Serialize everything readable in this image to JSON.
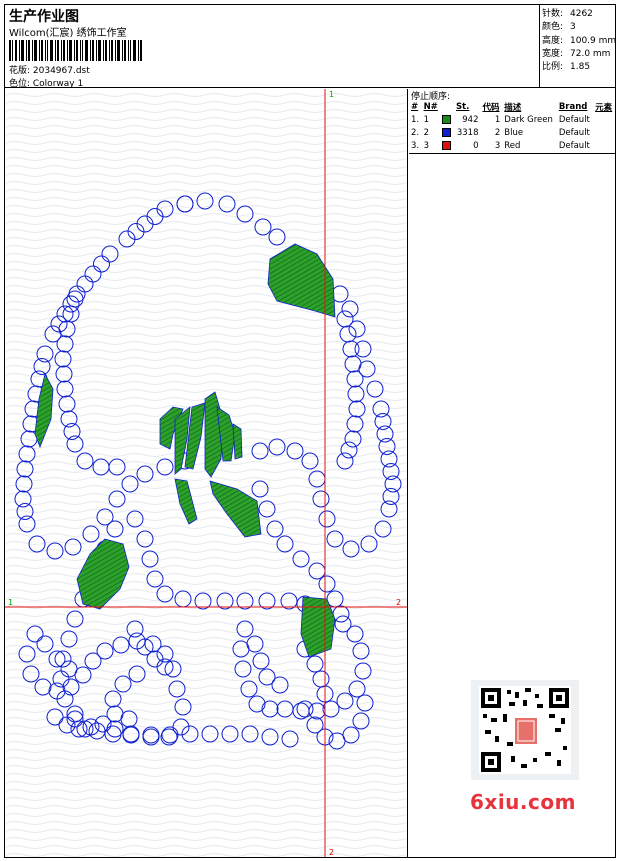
{
  "header": {
    "title": "生产作业图",
    "company": "Wilcom(汇宸) 绣饰工作室",
    "design_label": "花版: 2034967.dst",
    "colorway_label": "色位: Colorway 1"
  },
  "stats": [
    {
      "label": "针数:",
      "value": "4262"
    },
    {
      "label": "颜色:",
      "value": "3"
    },
    {
      "label": "高度:",
      "value": "100.9 mm"
    },
    {
      "label": "宽度:",
      "value": "72.0 mm"
    },
    {
      "label": "比例:",
      "value": "1.85"
    }
  ],
  "stop_sequence": {
    "heading": "停止顺序:",
    "columns": [
      "#",
      "N#",
      "St.",
      "代码",
      "描述",
      "Brand",
      "元素"
    ],
    "rows": [
      {
        "idx": "1.",
        "n": "1",
        "color": "#1a8a1a",
        "stitches": "942",
        "code": "1",
        "desc": "Dark Green",
        "brand": "Default",
        "element": ""
      },
      {
        "idx": "2.",
        "n": "2",
        "color": "#1020d0",
        "stitches": "3318",
        "code": "2",
        "desc": "Blue",
        "brand": "Default",
        "element": ""
      },
      {
        "idx": "3.",
        "n": "3",
        "color": "#e01010",
        "stitches": "0",
        "code": "3",
        "desc": "Red",
        "brand": "Default",
        "element": ""
      }
    ]
  },
  "axes": {
    "top": "1",
    "bottom": "2",
    "left": "1",
    "right": "2"
  },
  "watermark": "6xiu.com",
  "colors": {
    "stitch_blue": "#1020d0",
    "fill_green": "#1a8a1a",
    "crosshair_red": "#e01010"
  }
}
